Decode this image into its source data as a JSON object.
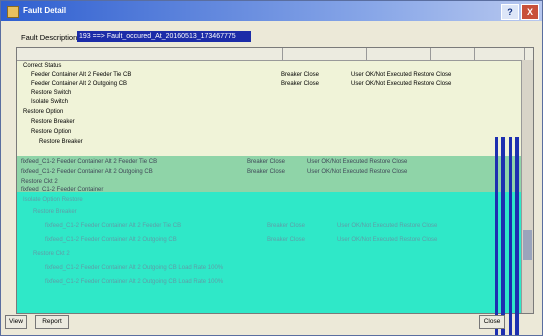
{
  "window": {
    "title": "Fault Detail",
    "help_label": "?",
    "close_label": "X"
  },
  "fault": {
    "label": "Fault Description",
    "value": "193 ==> Fault_occured_At_20160513_173467775"
  },
  "tree": {
    "columns": [
      "",
      "",
      "",
      "",
      ""
    ],
    "rows": [
      {
        "text": "Correct Status",
        "c1": "",
        "c2": "",
        "c3": "",
        "level": 0
      },
      {
        "text": "Feeder Container Alt 2 Feeder Tie CB",
        "c1": "Breaker Close",
        "c2": "User OK/Not Executed Restore Close",
        "c3": "",
        "level": 1
      },
      {
        "text": "Feeder Container Alt 2 Outgoing CB",
        "c1": "Breaker Close",
        "c2": "User OK/Not Executed Restore Close",
        "c3": "",
        "level": 1
      },
      {
        "text": "Restore Switch",
        "c1": "",
        "c2": "",
        "c3": "",
        "level": 1
      },
      {
        "text": "Isolate Switch",
        "c1": "",
        "c2": "",
        "c3": "",
        "level": 1
      },
      {
        "text": "Restore Option",
        "c1": "",
        "c2": "",
        "c3": "",
        "level": 0
      },
      {
        "text": "Restore Breaker",
        "c1": "",
        "c2": "",
        "c3": "",
        "level": 1
      },
      {
        "text": "Restore Option",
        "c1": "",
        "c2": "",
        "c3": "",
        "level": 1
      },
      {
        "text": "Restore Breaker",
        "c1": "",
        "c2": "",
        "c3": "",
        "level": 2
      }
    ],
    "band_rows": [
      {
        "text": "fixfeed_C1-2 Feeder Container Alt 2 Feeder Tie CB",
        "c1": "Breaker Close",
        "c2": "User OK/Not Executed Restore Close"
      },
      {
        "text": "fixfeed_C1-2 Feeder Container Alt 2 Outgoing CB",
        "c1": "Breaker Close",
        "c2": "User OK/Not Executed Restore Close"
      },
      {
        "text": "Restore Ckt 2",
        "c1": "",
        "c2": ""
      },
      {
        "text": "fixfeed_C1-2 Feeder Container",
        "c1": "",
        "c2": ""
      }
    ],
    "cyan_rows": [
      {
        "text": "Isolate Option Restore",
        "c1": "",
        "c2": ""
      },
      {
        "text": "Restore Breaker",
        "c1": "",
        "c2": ""
      },
      {
        "text": "fixfeed_C1-2 Feeder Container Alt 2 Feeder Tie CB",
        "c1": "Breaker Close",
        "c2": "User OK/Not Executed Restore Close"
      },
      {
        "text": "fixfeed_C1-2 Feeder Container Alt 2 Outgoing CB",
        "c1": "Breaker Close",
        "c2": "User OK/Not Executed Restore Close"
      },
      {
        "text": "Restore Ckt 2",
        "c1": "",
        "c2": ""
      },
      {
        "text": "fixfeed_C1-2 Feeder Container Alt 2 Outgoing CB Load Rate 100%",
        "c1": "",
        "c2": ""
      },
      {
        "text": "fixfeed_C1-2 Feeder Container Alt 2 Outgoing CB Load Rate 100%",
        "c1": "",
        "c2": ""
      }
    ]
  },
  "footer": {
    "view_label": "View",
    "report_label": "Report",
    "close_label": "Close"
  },
  "colors": {
    "selection": "#1c2ca8",
    "band_green": "#8fd4a8",
    "band_cyan": "#2fe8c8"
  }
}
